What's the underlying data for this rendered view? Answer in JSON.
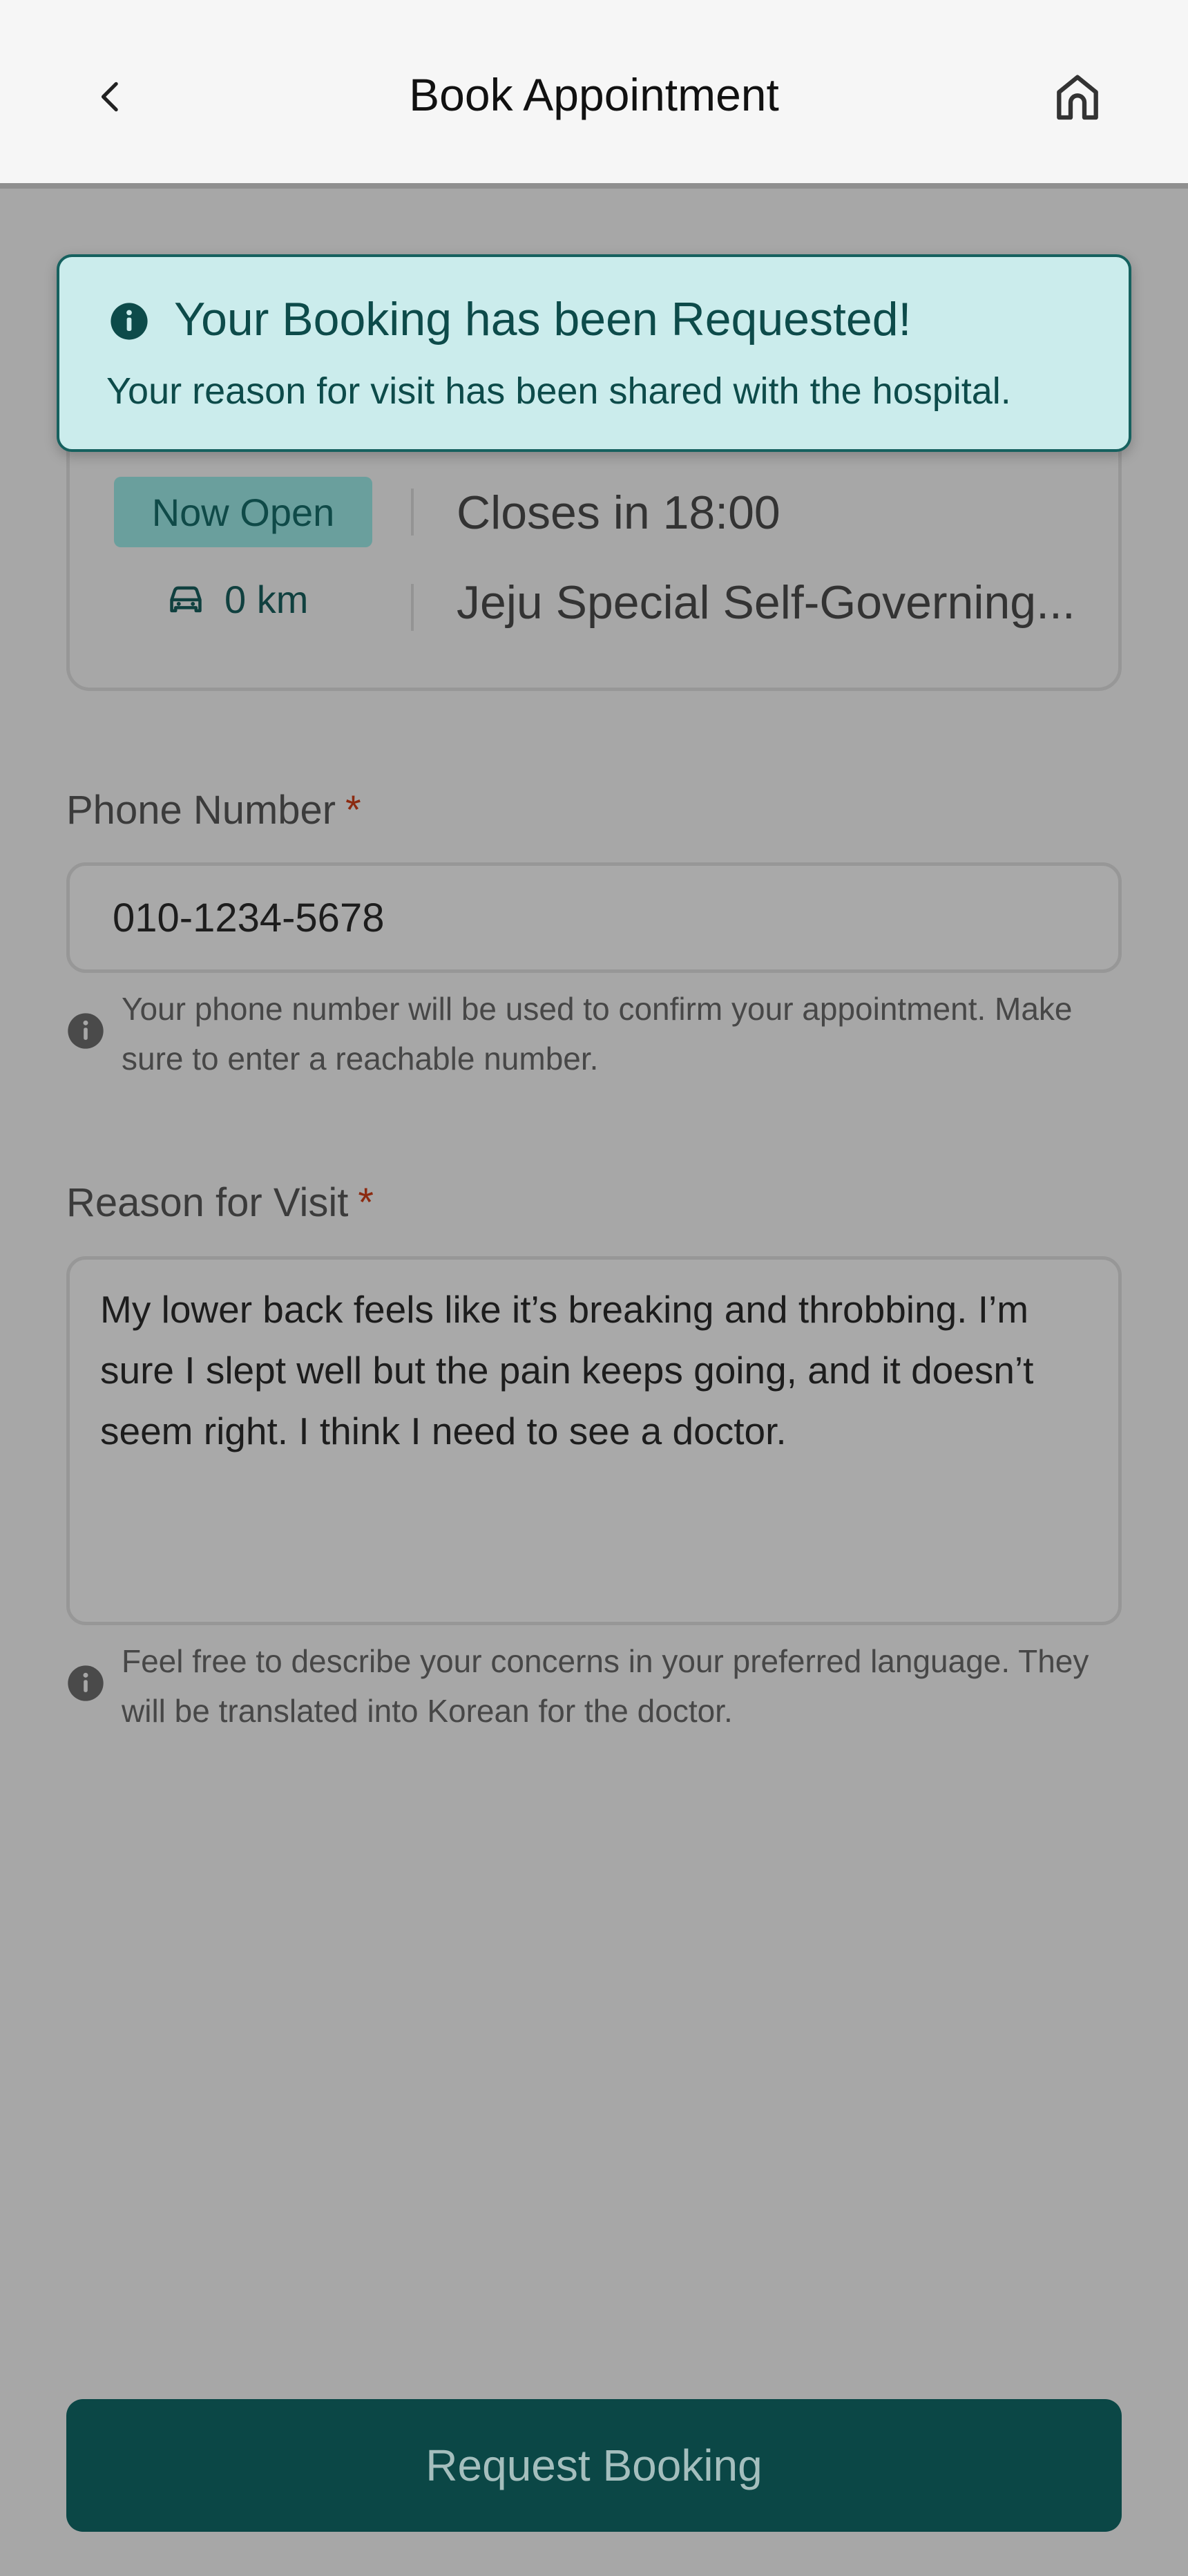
{
  "header": {
    "title": "Book Appointment",
    "back_icon": "chevron-left-icon",
    "home_icon": "home-icon"
  },
  "hospital_card": {
    "status_badge": "Now Open",
    "closing_text": "Closes in 18:00",
    "distance": "0 km",
    "distance_icon": "car-icon",
    "address": "Jeju Special Self-Governing..."
  },
  "toast": {
    "icon": "info-icon",
    "title": "Your Booking has been Requested!",
    "message": "Your reason for visit has been shared with the hospital."
  },
  "phone": {
    "label": "Phone Number",
    "required_mark": "*",
    "value": "010-1234-5678",
    "hint": "Your phone number will be used to confirm your appointment. Make sure to enter a reachable number."
  },
  "reason": {
    "label": "Reason for Visit",
    "required_mark": "*",
    "value": "My lower back feels like it’s breaking and throbbing. I’m sure I slept well but the pain keeps going, and it doesn’t seem right. I think I need to see a doctor.",
    "hint": "Feel free to describe your concerns in your preferred language. They will be translated into Korean for the doctor."
  },
  "submit": {
    "label": "Request Booking"
  },
  "colors": {
    "primary": "#0b4746",
    "toast_bg": "#cbecec",
    "required": "#8c2a10",
    "overlay": "#a7a7a7"
  }
}
